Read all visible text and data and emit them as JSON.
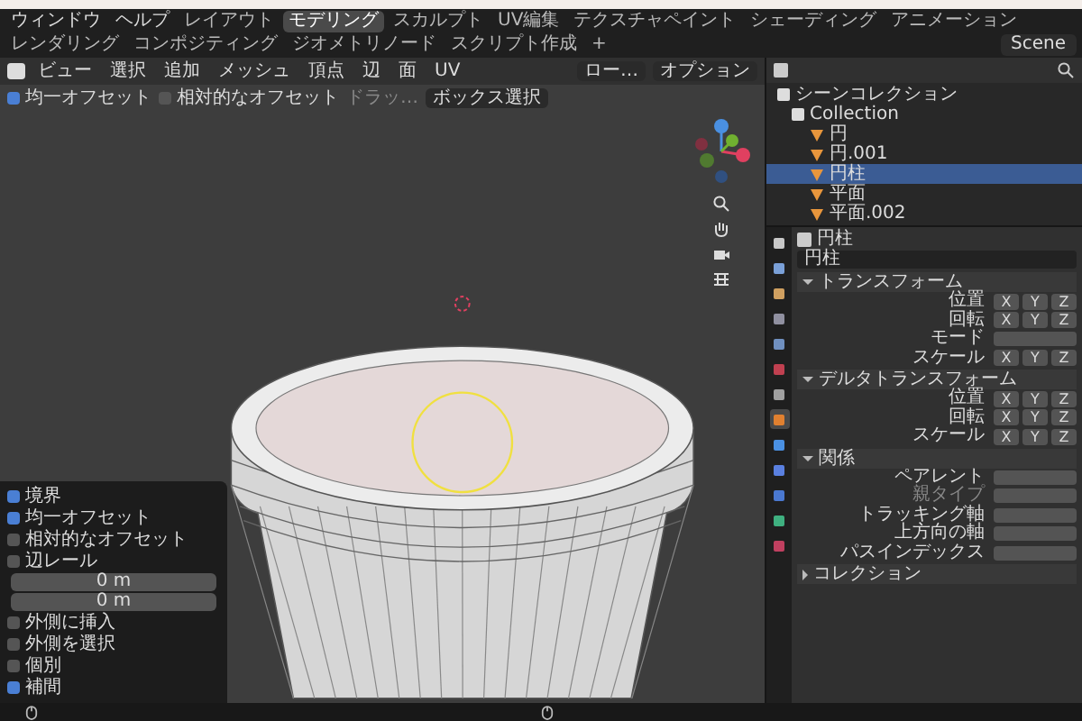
{
  "menu": [
    "ウィンドウ",
    "ヘルプ"
  ],
  "workspace_tabs": [
    {
      "label": "レイアウト",
      "selected": false
    },
    {
      "label": "モデリング",
      "selected": true
    },
    {
      "label": "スカルプト",
      "selected": false
    },
    {
      "label": "UV編集",
      "selected": false
    },
    {
      "label": "テクスチャペイント",
      "selected": false
    },
    {
      "label": "シェーディング",
      "selected": false
    },
    {
      "label": "アニメーション",
      "selected": false
    },
    {
      "label": "レンダリング",
      "selected": false
    },
    {
      "label": "コンポジティング",
      "selected": false
    },
    {
      "label": "ジオメトリノード",
      "selected": false
    },
    {
      "label": "スクリプト作成",
      "selected": false
    }
  ],
  "add_tab": "+",
  "scene": "Scene",
  "viewport_header": {
    "menus": [
      "ビュー",
      "選択",
      "追加",
      "メッシュ",
      "頂点",
      "辺",
      "面",
      "UV"
    ],
    "orientation": "ロー…",
    "options": "オプション"
  },
  "tool_options": [
    {
      "kind": "checkbox",
      "label": "均一オフセット",
      "checked": true
    },
    {
      "kind": "checkbox",
      "label": "相対的なオフセット",
      "checked": false
    },
    {
      "kind": "label",
      "label": "ドラッ…"
    },
    {
      "kind": "dropdown",
      "label": "ボックス選択"
    }
  ],
  "outliner": {
    "root": "シーンコレクション",
    "children": [
      {
        "label": "Collection",
        "selected": false,
        "children": [
          {
            "label": "円",
            "selected": false
          },
          {
            "label": "円.001",
            "selected": false
          },
          {
            "label": "円柱",
            "selected": true
          },
          {
            "label": "平面",
            "selected": false
          },
          {
            "label": "平面.002",
            "selected": false
          }
        ]
      }
    ]
  },
  "property_tabs": [
    {
      "selected": false
    },
    {
      "selected": false
    },
    {
      "selected": false
    },
    {
      "selected": false
    },
    {
      "selected": false
    },
    {
      "selected": false
    },
    {
      "selected": false
    },
    {
      "selected": true
    },
    {
      "selected": false
    },
    {
      "selected": false
    },
    {
      "selected": false
    },
    {
      "selected": false
    },
    {
      "selected": false
    }
  ],
  "properties": {
    "object_name": "円柱",
    "data_name": "円柱",
    "sections": [
      {
        "title": "トランスフォーム",
        "expanded": true,
        "rows": [
          {
            "kind": "vector",
            "label": "位置",
            "axes": [
              "X",
              "Y",
              "Z"
            ],
            "disabled": false
          },
          {
            "kind": "vector",
            "label": "回転",
            "axes": [
              "X",
              "Y",
              "Z"
            ],
            "disabled": false
          },
          {
            "kind": "field",
            "label": "モード",
            "disabled": false
          },
          {
            "kind": "vector",
            "label": "スケール",
            "axes": [
              "X",
              "Y",
              "Z"
            ],
            "disabled": false
          }
        ]
      },
      {
        "title": "デルタトランスフォーム",
        "expanded": true,
        "rows": [
          {
            "kind": "vector",
            "label": "位置",
            "axes": [
              "X",
              "Y",
              "Z"
            ],
            "disabled": false
          },
          {
            "kind": "vector",
            "label": "回転",
            "axes": [
              "X",
              "Y",
              "Z"
            ],
            "disabled": false
          },
          {
            "kind": "vector",
            "label": "スケール",
            "axes": [
              "X",
              "Y",
              "Z"
            ],
            "disabled": false
          }
        ]
      },
      {
        "title": "関係",
        "expanded": true,
        "rows": [
          {
            "kind": "field",
            "label": "ペアレント",
            "disabled": false
          },
          {
            "kind": "field",
            "label": "親タイプ",
            "disabled": true
          },
          {
            "kind": "field",
            "label": "トラッキング軸",
            "disabled": false
          },
          {
            "kind": "field",
            "label": "上方向の軸",
            "disabled": false
          },
          {
            "kind": "field",
            "label": "パスインデックス",
            "disabled": false
          }
        ]
      },
      {
        "title": "コレクション",
        "expanded": false
      }
    ]
  },
  "last_operation": [
    {
      "kind": "checkbox",
      "label": "境界",
      "checked": true
    },
    {
      "kind": "checkbox",
      "label": "均一オフセット",
      "checked": true
    },
    {
      "kind": "checkbox",
      "label": "相対的なオフセット",
      "checked": false
    },
    {
      "kind": "checkbox",
      "label": "辺レール",
      "checked": false
    },
    {
      "kind": "value",
      "value": "0 m"
    },
    {
      "kind": "value",
      "value": "0 m"
    },
    {
      "kind": "checkbox",
      "label": "外側に挿入",
      "checked": false
    },
    {
      "kind": "checkbox",
      "label": "外側を選択",
      "checked": false
    },
    {
      "kind": "checkbox",
      "label": "個別",
      "checked": false
    },
    {
      "kind": "checkbox",
      "label": "補間",
      "checked": true
    }
  ]
}
